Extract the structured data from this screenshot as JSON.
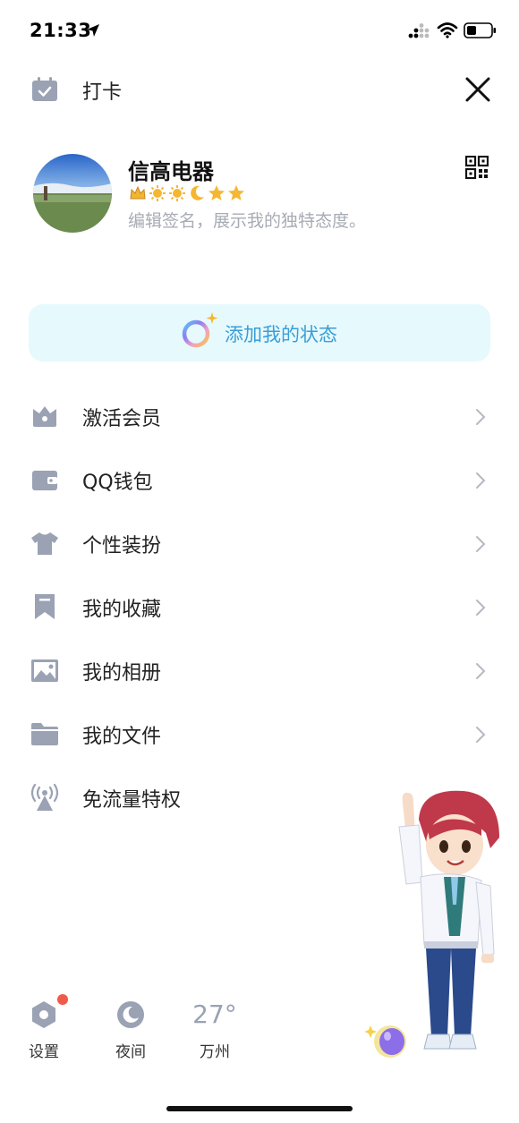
{
  "status_bar": {
    "time": "21:33"
  },
  "header": {
    "checkin_label": "打卡",
    "checkin_icon": "calendar-check-icon",
    "close_icon": "close-icon"
  },
  "profile": {
    "name": "信高电器",
    "signature": "编辑签名，展示我的独特态度。",
    "level_icons": [
      "crown-icon",
      "sun-icon",
      "sun-icon",
      "moon-icon",
      "star-icon",
      "star-icon"
    ]
  },
  "status_button": {
    "label": "添加我的状态"
  },
  "menu": [
    {
      "label": "激活会员",
      "icon": "vip-crown-icon",
      "chevron": true
    },
    {
      "label": "QQ钱包",
      "icon": "wallet-icon",
      "chevron": true
    },
    {
      "label": "个性装扮",
      "icon": "tshirt-icon",
      "chevron": true
    },
    {
      "label": "我的收藏",
      "icon": "bookmark-icon",
      "chevron": true
    },
    {
      "label": "我的相册",
      "icon": "photo-icon",
      "chevron": true
    },
    {
      "label": "我的文件",
      "icon": "folder-icon",
      "chevron": true
    },
    {
      "label": "免流量特权",
      "icon": "broadcast-tower-icon",
      "chevron": false
    }
  ],
  "bottom_bar": {
    "settings_label": "设置",
    "night_label": "夜间",
    "weather_temp": "27°",
    "weather_city": "万州"
  },
  "colors": {
    "icon_gray": "#9aa2b3",
    "status_bg": "#e6f9fd",
    "status_text": "#3a9ed6",
    "badge_red": "#f05a4a"
  }
}
